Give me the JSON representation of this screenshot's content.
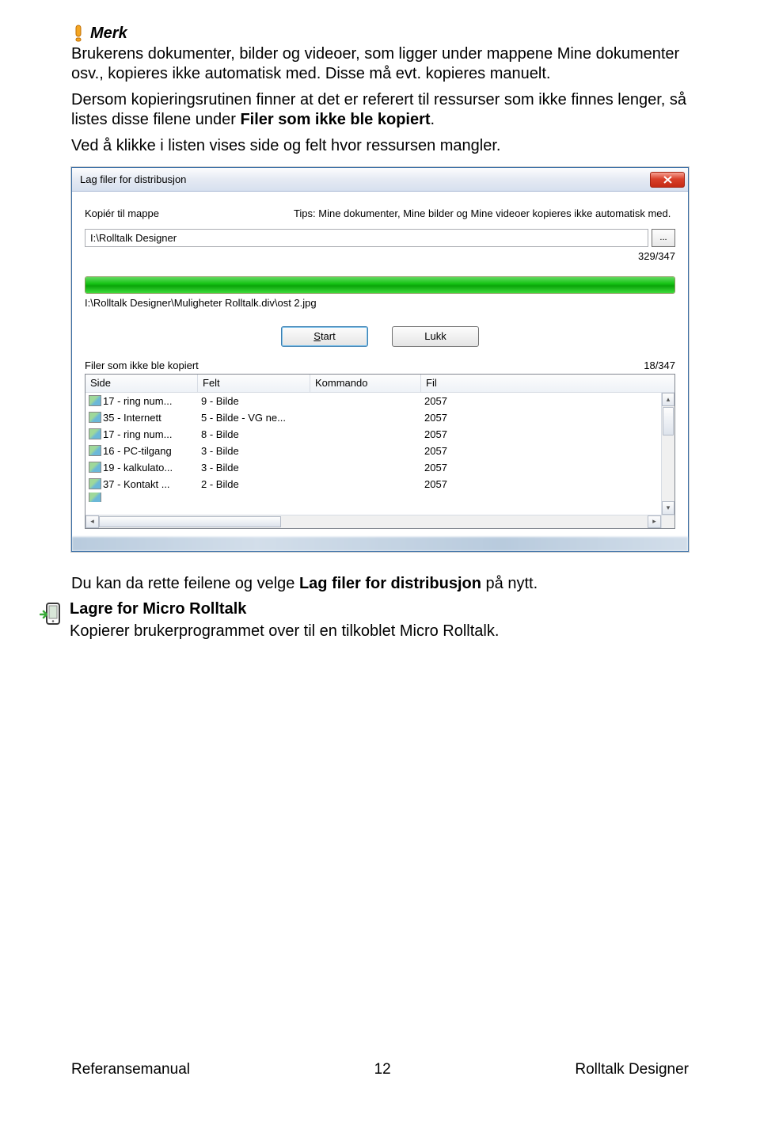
{
  "note": {
    "title": "Merk",
    "p1a": "Brukerens dokumenter, bilder og videoer, som ligger under mappene Mine dokumenter osv., kopieres ikke automatisk med. Disse må evt. kopieres manuelt.",
    "p2a": "Dersom kopieringsrutinen finner at det er referert til ressurser som ikke finnes lenger, så listes disse filene under ",
    "p2b": "Filer som ikke ble kopiert",
    "p2c": ".",
    "p3": "Ved å klikke i listen vises side og felt hvor ressursen mangler."
  },
  "dialog": {
    "title": "Lag filer for distribusjon",
    "copy_to_label": "Kopiér til mappe",
    "tips": "Tips: Mine dokumenter, Mine bilder og Mine videoer kopieres ikke automatisk med.",
    "path_value": "I:\\Rolltalk Designer",
    "browse_dots": "...",
    "counter": "329/347",
    "status_path": "I:\\Rolltalk Designer\\Muligheter Rolltalk.div\\ost 2.jpg",
    "start_btn": "Start",
    "close_btn": "Lukk",
    "section_label": "Filer som ikke ble kopiert",
    "section_count": "18/347",
    "columns": {
      "side": "Side",
      "felt": "Felt",
      "kommando": "Kommando",
      "fil": "Fil"
    },
    "rows": [
      {
        "side": "17 - ring num...",
        "felt": "9 - Bilde",
        "fil": "2057"
      },
      {
        "side": "35 - Internett",
        "felt": "5 - Bilde - VG ne...",
        "fil": "2057"
      },
      {
        "side": "17 - ring num...",
        "felt": "8 - Bilde",
        "fil": "2057"
      },
      {
        "side": "16 - PC-tilgang",
        "felt": "3 - Bilde",
        "fil": "2057"
      },
      {
        "side": "19 - kalkulato...",
        "felt": "3 - Bilde",
        "fil": "2057"
      },
      {
        "side": "37 - Kontakt ...",
        "felt": "2 - Bilde",
        "fil": "2057"
      }
    ]
  },
  "after": {
    "p1a": "Du kan da rette feilene og velge ",
    "p1b": "Lag filer for distribusjon",
    "p1c": " på nytt.",
    "heading": "Lagre for Micro Rolltalk",
    "p2": "Kopierer brukerprogrammet over til en tilkoblet Micro Rolltalk."
  },
  "footer": {
    "left": "Referansemanual",
    "center": "12",
    "right": "Rolltalk Designer"
  }
}
